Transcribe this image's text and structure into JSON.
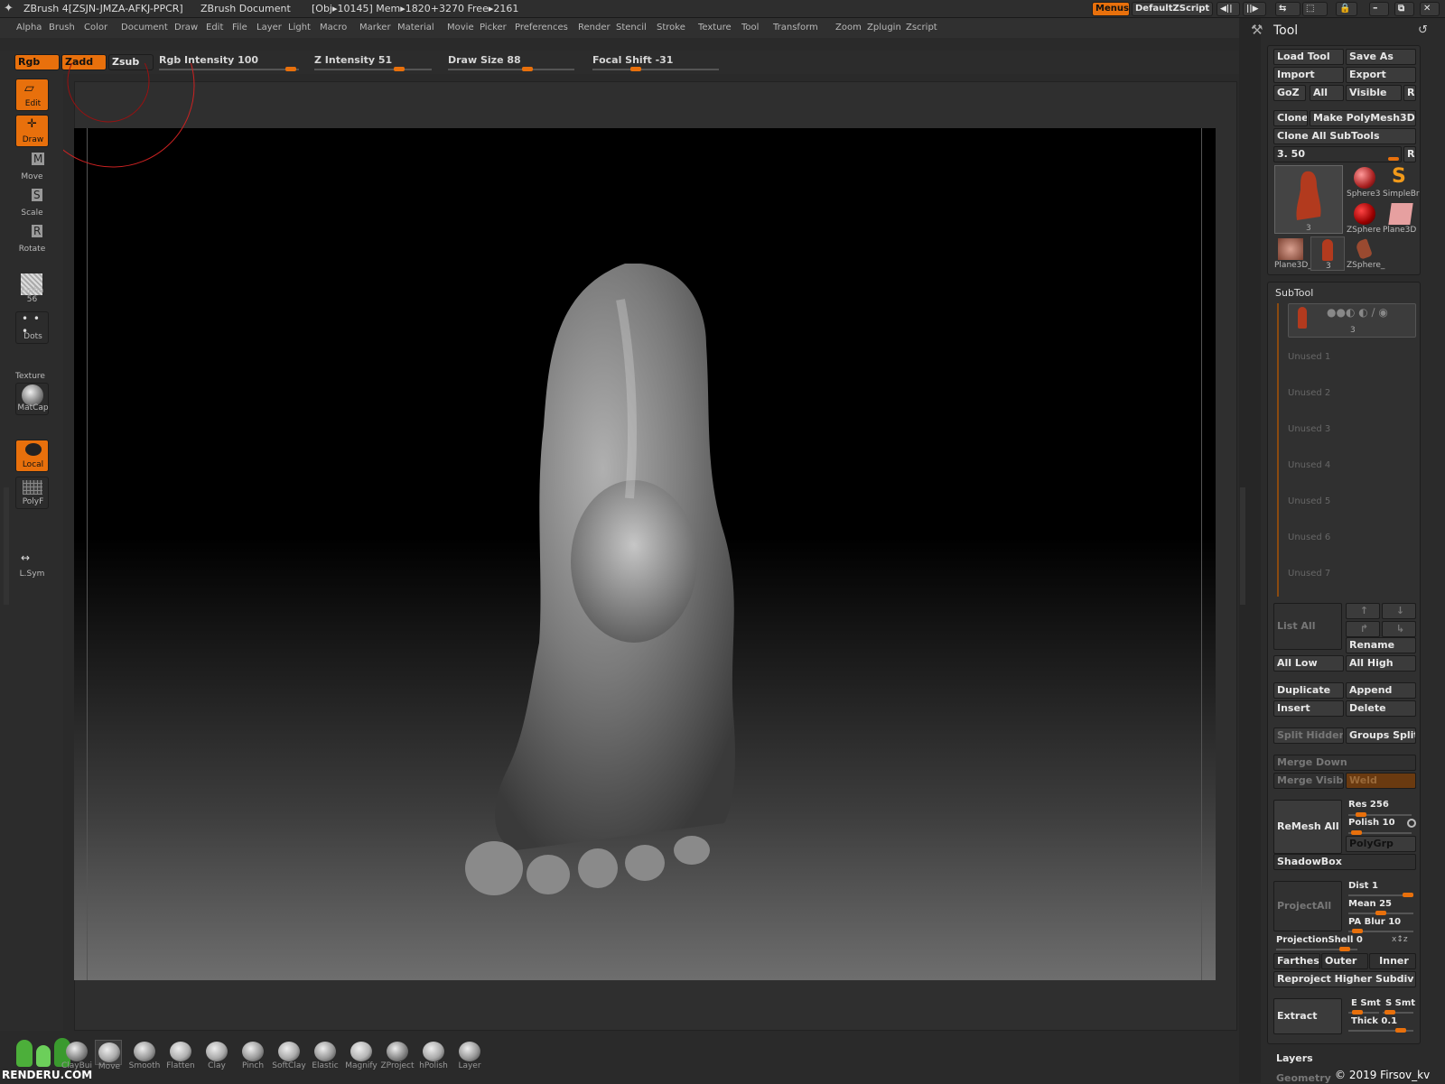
{
  "titlebar": {
    "app_title": "ZBrush 4[ZSJN-JMZA-AFKJ-PPCR]",
    "document": "ZBrush Document",
    "stats": "[Obj▸10145] Mem▸1820+3270 Free▸2161",
    "menus_button": "Menus",
    "script_button": "DefaultZScript"
  },
  "menubar": [
    "Alpha",
    "Brush",
    "Color",
    "Document",
    "Draw",
    "Edit",
    "File",
    "Layer",
    "Light",
    "Macro",
    "Marker",
    "Material",
    "Movie",
    "Picker",
    "Preferences",
    "Render",
    "Stencil",
    "Stroke",
    "Texture",
    "Tool",
    "Transform",
    "Zoom",
    "Zplugin",
    "Zscript"
  ],
  "shelf": {
    "rgb": "Rgb",
    "zadd": "Zadd",
    "zsub": "Zsub",
    "rgb_intensity_label": "Rgb Intensity 100",
    "rgb_intensity_value": 100,
    "z_intensity_label": "Z Intensity 51",
    "z_intensity_value": 51,
    "draw_size_label": "Draw Size 88",
    "draw_size_value": 88,
    "focal_shift_label": "Focal Shift -31",
    "focal_shift_value": -31
  },
  "leftbar": {
    "edit": "Edit",
    "draw": "Draw",
    "move": "Move",
    "scale": "Scale",
    "rotate": "Rotate",
    "alpha": "Alpha 56",
    "dots": "Dots",
    "texture": "Texture",
    "matcap": "MatCap",
    "local": "Local",
    "polyf": "PolyF",
    "lsym": "L.Sym"
  },
  "brushes": [
    "ClayBui",
    "Move",
    "Smooth",
    "Flatten",
    "Clay",
    "Pinch",
    "SoftClay",
    "Elastic",
    "Magnify",
    "ZProject",
    "hPolish",
    "Layer"
  ],
  "tool_panel": {
    "title": "Tool",
    "load_tool": "Load Tool",
    "save_as": "Save As",
    "import": "Import",
    "export": "Export",
    "goz": "GoZ",
    "all": "All",
    "visible": "Visible",
    "r": "R",
    "clone": "Clone",
    "make_polymesh": "Make PolyMesh3D",
    "clone_all": "Clone All SubTools",
    "size_value": "3. 50",
    "thumbs": [
      {
        "label": "3"
      },
      {
        "label": "Sphere3"
      },
      {
        "label": "SimpleBr"
      },
      {
        "label": "ZSphere"
      },
      {
        "label": "Plane3D"
      },
      {
        "label": "Plane3D_"
      },
      {
        "label": "3"
      },
      {
        "label": "ZSphere_"
      }
    ]
  },
  "subtool": {
    "title": "SubTool",
    "active_label": "3",
    "unused": [
      "Unused 1",
      "Unused 2",
      "Unused 3",
      "Unused 4",
      "Unused 5",
      "Unused 6",
      "Unused 7"
    ],
    "list_all": "List All",
    "rename": "Rename",
    "all_low": "All Low",
    "all_high": "All High",
    "duplicate": "Duplicate",
    "append": "Append",
    "insert": "Insert",
    "delete": "Delete",
    "split_hidden": "Split Hidden",
    "groups_split": "Groups Split",
    "merge_down": "Merge Down",
    "merge_visible": "Merge Visible",
    "weld": "Weld",
    "remesh_all": "ReMesh All",
    "res": "Res 256",
    "polish": "Polish 10",
    "polygrp": "PolyGrp",
    "shadowbox": "ShadowBox",
    "projectall": "ProjectAll",
    "dist": "Dist 1",
    "mean": "Mean 25",
    "pa_blur": "PA Blur 10",
    "projection_shell": "ProjectionShell 0",
    "farthest": "Farthest",
    "outer": "Outer",
    "inner": "Inner",
    "reproject": "Reproject Higher Subdiv",
    "extract": "Extract",
    "e_smt": "E Smt",
    "s_smt": "S Smt",
    "thick": "Thick 0.1",
    "layers": "Layers",
    "geometry": "Geometry"
  },
  "watermark": {
    "logo": "RENDERU.COM",
    "credit": "© 2019 Firsov_kv"
  },
  "colors": {
    "accent": "#e8700c",
    "panel": "#2b2b2b",
    "button": "#3b3b3b"
  }
}
